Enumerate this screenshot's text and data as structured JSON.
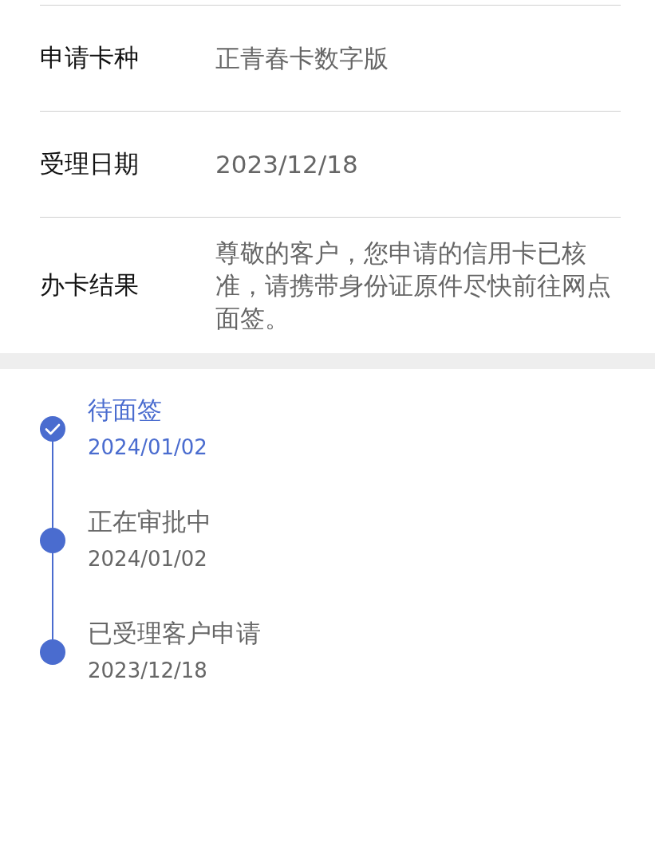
{
  "details": [
    {
      "label": "申请卡种",
      "value": "正青春卡数字版"
    },
    {
      "label": "受理日期",
      "value": "2023/12/18"
    },
    {
      "label": "办卡结果",
      "value": "尊敬的客户，您申请的信用卡已核准，请携带身份证原件尽快前往网点面签。"
    }
  ],
  "timeline": [
    {
      "title": "待面签",
      "date": "2024/01/02",
      "selected": true
    },
    {
      "title": "正在审批中",
      "date": "2024/01/02",
      "selected": false
    },
    {
      "title": "已受理客户申请",
      "date": "2023/12/18",
      "selected": false
    }
  ]
}
